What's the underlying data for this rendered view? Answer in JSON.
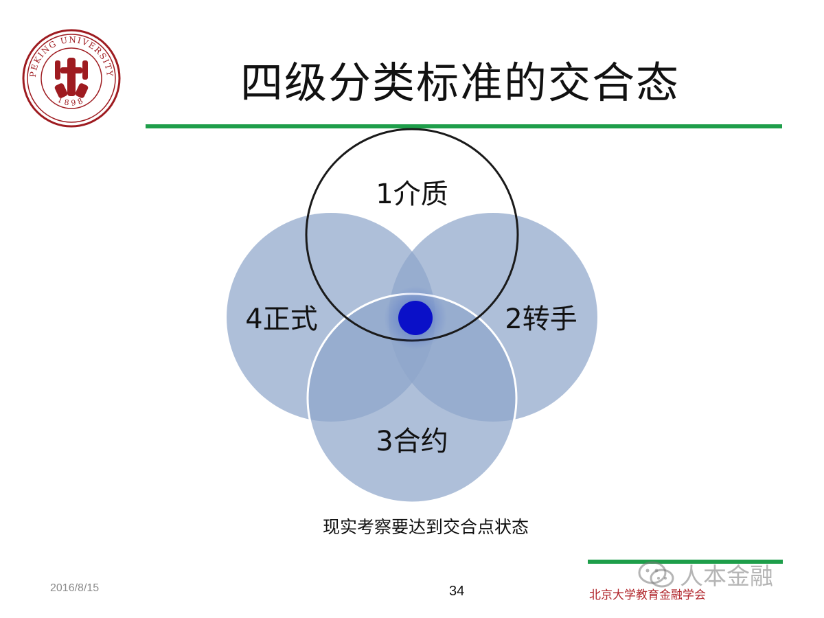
{
  "logo": {
    "ring_text": "PEKING UNIVERSITY",
    "year": "1898",
    "color": "#9e1b20"
  },
  "slide": {
    "title": "四级分类标准的交合态",
    "accent_color": "#1e9e4a"
  },
  "venn": {
    "circles": [
      {
        "label": "1介质",
        "fill": "none",
        "stroke": "#1a1a1a"
      },
      {
        "label": "2转手",
        "fill": "#9fb3d3"
      },
      {
        "label": "3合约",
        "fill": "#9fb3d3"
      },
      {
        "label": "4正式",
        "fill": "#9fb3d3"
      }
    ],
    "center_marker_color": "#0a10c8"
  },
  "caption": "现实考察要达到交合点状态",
  "footer": {
    "date": "2016/8/15",
    "page_number": "34",
    "org": "北京大学教育金融学会"
  },
  "watermark": {
    "text": "人本金融",
    "icon": "wechat-icon"
  }
}
